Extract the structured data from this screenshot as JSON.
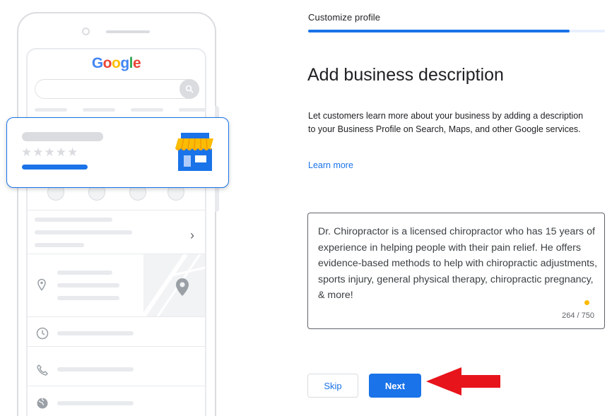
{
  "illustration": {
    "logo_letters": [
      {
        "char": "G",
        "color": "#4285F4"
      },
      {
        "char": "o",
        "color": "#EA4335"
      },
      {
        "char": "o",
        "color": "#FBBC05"
      },
      {
        "char": "g",
        "color": "#4285F4"
      },
      {
        "char": "l",
        "color": "#34A853"
      },
      {
        "char": "e",
        "color": "#EA4335"
      }
    ],
    "business_card": {
      "stars": "★★★★★",
      "icon": "storefront-icon"
    }
  },
  "header": {
    "step_label": "Customize profile",
    "progress_percent": 88
  },
  "main": {
    "title": "Add business description",
    "description": "Let customers learn more about your business by adding a description to your Business Profile on Search, Maps, and other Google services.",
    "learn_more_label": "Learn more",
    "text_area": {
      "value": "Dr. Chiropractor is a licensed chiropractor who has 15 years of experience in helping people with their pain relief. He offers evidence-based methods to help with chiropractic adjustments, sports injury, general physical therapy, chiropractic pregnancy, & more!",
      "counter": "264 / 750"
    }
  },
  "footer": {
    "skip_label": "Skip",
    "next_label": "Next"
  },
  "colors": {
    "accent": "#1a73e8",
    "annotation_arrow": "#e8141c",
    "indicator_dot": "#fbbc04"
  }
}
